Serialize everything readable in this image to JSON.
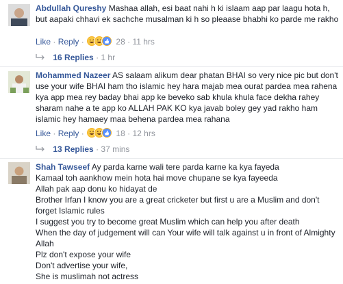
{
  "comments": [
    {
      "name": "Abdullah Qureshy",
      "text": "Mashaa allah, esi baat nahi h ki islaam aap par laagu hota h, but aapaki chhavi ek sachche musalman ki h so pleaase bhabhi ko parde me rakho",
      "like": "Like",
      "reply": "Reply",
      "count": "28",
      "time": "11 hrs",
      "replies_label": "16 Replies",
      "replies_time": "1 hr"
    },
    {
      "name": "Mohammed Nazeer",
      "text": "AS salaam alikum dear phatan BHAI so very nice pic but don't use your wife BHAI ham tho islamic hey hara majab mea ourat pardea mea rahena kya app mea rey baday bhai app ke beveko sab khula khula face dekha rahey sharam nahe a te app ko ALLAH PAK KO kya javab boley gey yad rakho ham islamic hey hamaey maa behena pardea mea rahana",
      "like": "Like",
      "reply": "Reply",
      "count": "18",
      "time": "12 hrs",
      "replies_label": "13 Replies",
      "replies_time": "37 mins"
    },
    {
      "name": "Shah Tawseef",
      "lines": [
        "Ay parda karne wali tere parda karne ka kya fayeda",
        "Kamaal toh aankhow mein hota hai move chupane se kya fayeeda",
        "Allah pak aap donu ko hidayat de",
        "Brother Irfan I know you are a great cricketer but first u are a Muslim and don't forget Islamic rules",
        "I suggest you try to become great Muslim which can help you after death",
        "When the day of judgement will can Your wife will talk against u in front of Almighty Allah",
        "Plz don't expose your wife",
        "Don't advertise your wife,",
        "She is muslimah not actress"
      ]
    }
  ],
  "icons": {
    "reaction_1": "haha-icon",
    "reaction_2": "haha-icon",
    "reaction_3": "like-icon",
    "reply": "reply-arrow-icon"
  },
  "colors": {
    "link": "#365899",
    "meta": "#90949c",
    "text": "#1d2129",
    "divider": "#e9ebee"
  }
}
